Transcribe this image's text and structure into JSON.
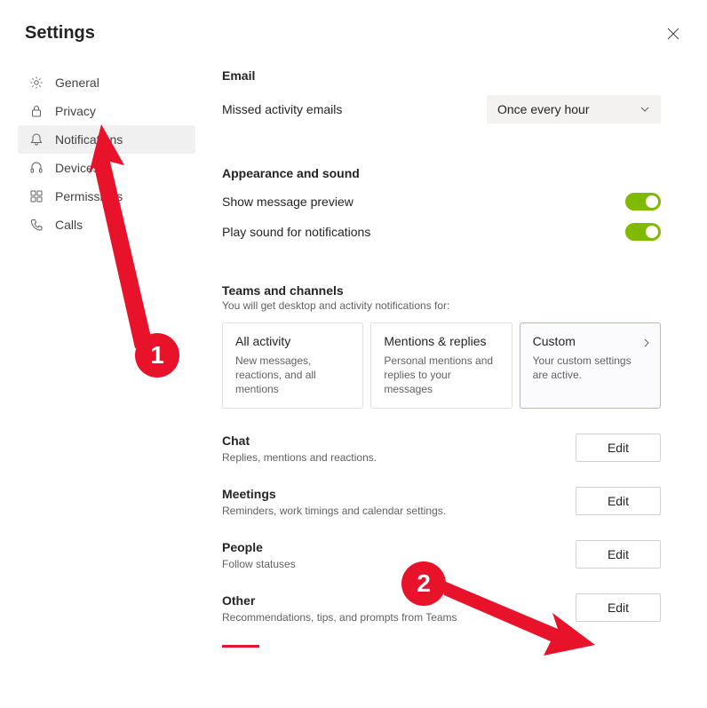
{
  "title": "Settings",
  "sidebar": {
    "items": [
      {
        "label": "General"
      },
      {
        "label": "Privacy"
      },
      {
        "label": "Notifications"
      },
      {
        "label": "Devices"
      },
      {
        "label": "Permissions"
      },
      {
        "label": "Calls"
      }
    ]
  },
  "email": {
    "title": "Email",
    "missed_label": "Missed activity emails",
    "dropdown_value": "Once every hour"
  },
  "appearance": {
    "title": "Appearance and sound",
    "preview_label": "Show message preview",
    "sound_label": "Play sound for notifications"
  },
  "teams": {
    "title": "Teams and channels",
    "subtitle": "You will get desktop and activity notifications for:",
    "cards": [
      {
        "title": "All activity",
        "desc": "New messages, reactions, and all mentions"
      },
      {
        "title": "Mentions & replies",
        "desc": "Personal mentions and replies to your messages"
      },
      {
        "title": "Custom",
        "desc": "Your custom settings are active."
      }
    ]
  },
  "sections": {
    "chat": {
      "title": "Chat",
      "desc": "Replies, mentions and reactions.",
      "btn": "Edit"
    },
    "meetings": {
      "title": "Meetings",
      "desc": "Reminders, work timings and calendar settings.",
      "btn": "Edit"
    },
    "people": {
      "title": "People",
      "desc": "Follow statuses",
      "btn": "Edit"
    },
    "other": {
      "title": "Other",
      "desc": "Recommendations, tips, and prompts from Teams",
      "btn": "Edit"
    }
  },
  "annotations": {
    "badge1": "1",
    "badge2": "2"
  }
}
